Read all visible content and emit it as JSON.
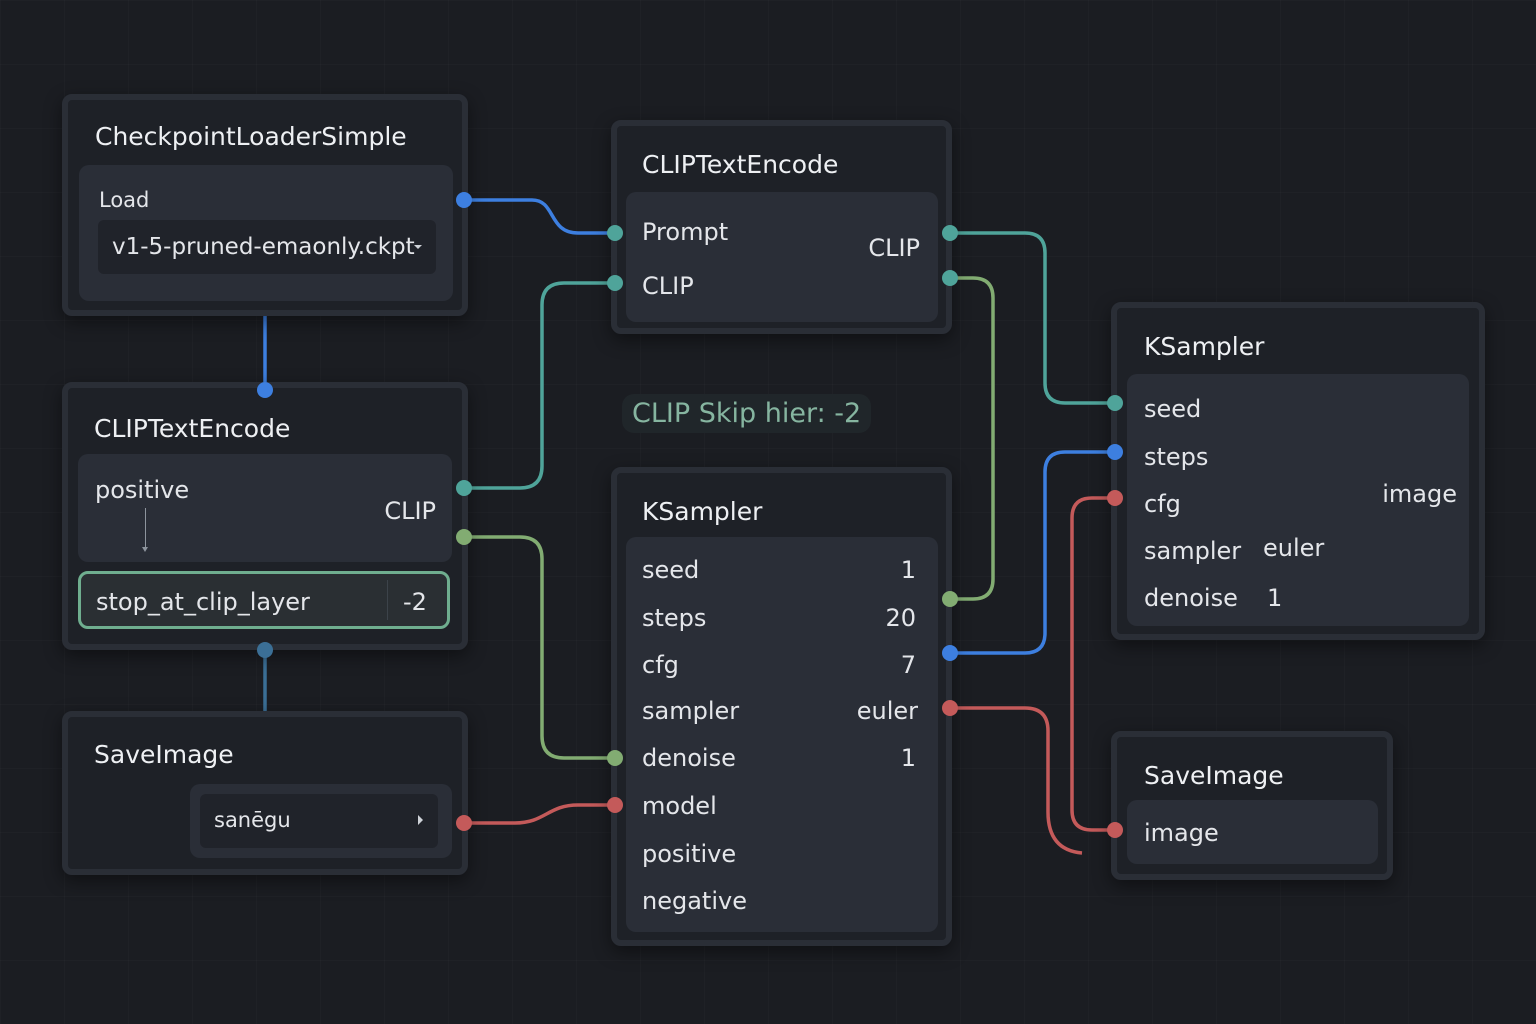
{
  "colors": {
    "background": "#1b1d22",
    "node": "#1e2127",
    "wire_blue": "#3d7fe0",
    "wire_teal": "#4fa49a",
    "wire_green": "#82ac72",
    "wire_red": "#c45a5a",
    "highlight": "#6fae8f"
  },
  "checkpoint_loader": {
    "title": "CheckpointLoaderSimple",
    "load_label": "Load",
    "ckpt_value": "v1-5-pruned-emaonly.ckpt",
    "dropdown_icon": "caret-down-icon"
  },
  "clip_encode_left": {
    "title": "CLIPTextEncode",
    "positive_label": "positive",
    "clip_output": "CLIP",
    "stop_label": "stop_at_clip_layer",
    "stop_value": "-2"
  },
  "save_image_left": {
    "title": "SaveImage",
    "filename_value": "sanēgu",
    "arrow_icon": "caret-right-icon"
  },
  "clip_encode_top": {
    "title": "CLIPTextEncode",
    "prompt_label": "Prompt",
    "clip_input": "CLIP",
    "clip_output": "CLIP"
  },
  "annotation": "CLIP Skip hier: -2",
  "ksampler_center": {
    "title": "KSampler",
    "rows": [
      {
        "label": "seed",
        "value": "1"
      },
      {
        "label": "steps",
        "value": "20"
      },
      {
        "label": "cfg",
        "value": "7"
      },
      {
        "label": "sampler",
        "value": "euler"
      },
      {
        "label": "denoise",
        "value": "1"
      }
    ],
    "model_label": "model",
    "positive_label": "positive",
    "negative_label": "negative"
  },
  "ksampler_right": {
    "title": "KSampler",
    "seed_label": "seed",
    "steps_label": "steps",
    "cfg_label": "cfg",
    "sampler_label": "sampler",
    "sampler_value": "euler",
    "denoise_label": "denoise",
    "denoise_value": "1",
    "image_output": "image"
  },
  "save_image_right": {
    "title": "SaveImage",
    "image_label": "image"
  }
}
